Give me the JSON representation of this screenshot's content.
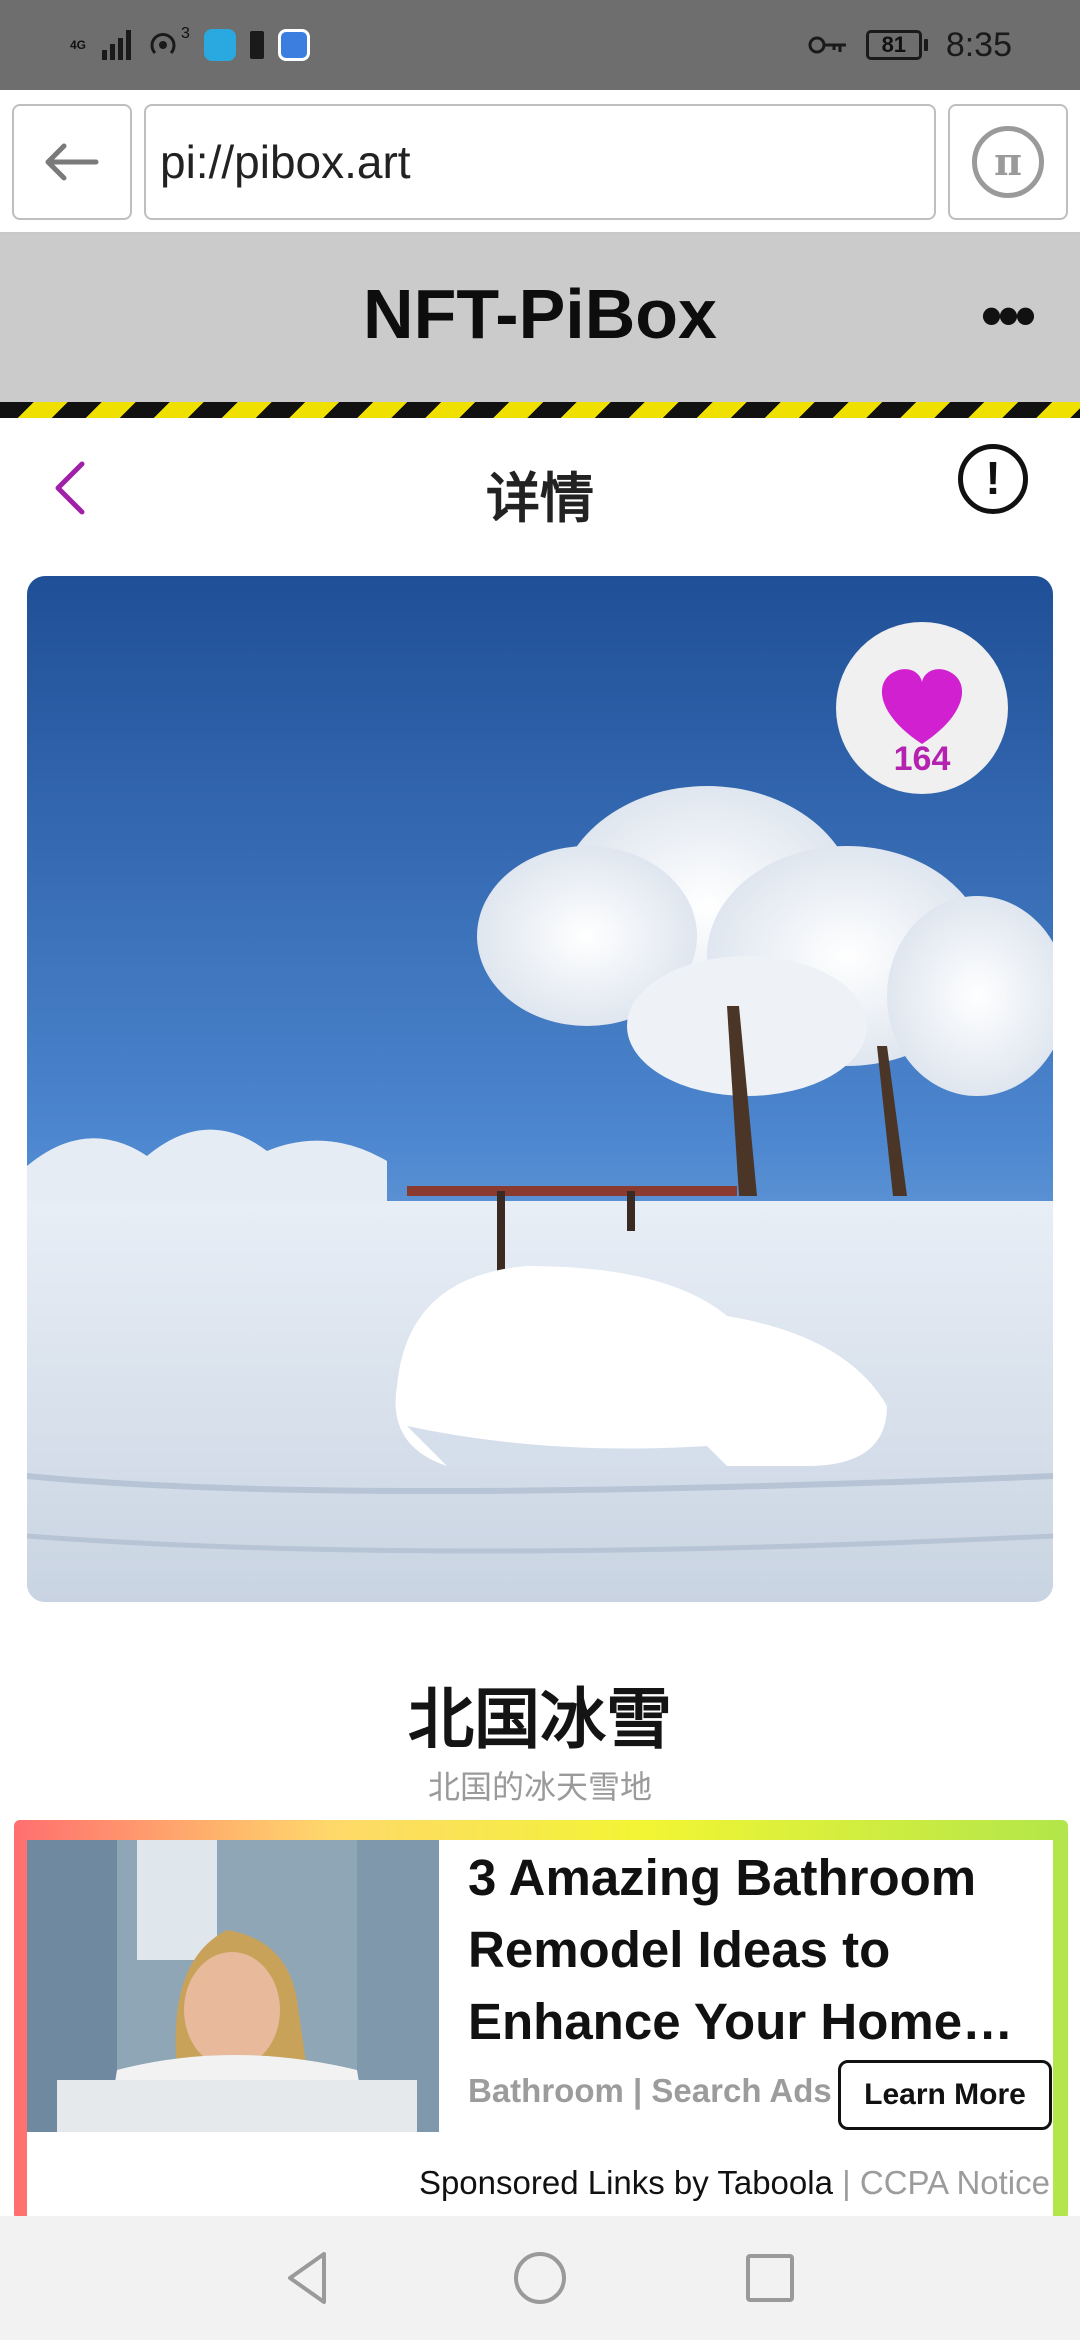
{
  "status_bar": {
    "network": "4G",
    "hotspot_count": "3",
    "battery": "81",
    "time": "8:35"
  },
  "browser": {
    "url": "pi://pibox.art",
    "pi_logo": "π"
  },
  "site": {
    "title": "NFT-PiBox",
    "more_label": "•••"
  },
  "detail": {
    "title": "详情",
    "info_label": "!"
  },
  "artwork": {
    "likes": "164",
    "name": "北国冰雪",
    "description": "北国的冰天雪地"
  },
  "ad": {
    "headline": "3 Amazing Bathroom Remodel Ideas to Enhance Your Home…",
    "source": "Bathroom | Search Ads",
    "cta": "Learn More",
    "sponsored": "Sponsored Links by Taboola",
    "separator": "|",
    "ccpa": "CCPA Notice"
  },
  "icons": {
    "status": [
      "signal-icon",
      "hotspot-icon",
      "app-icon-blue",
      "battery-saver-icon",
      "app-icon-browser",
      "key-icon",
      "battery-icon"
    ],
    "nav": [
      "back-triangle-icon",
      "home-circle-icon",
      "recents-square-icon"
    ]
  },
  "colors": {
    "status_bar": "#6e6e6e",
    "site_header": "#cbcbcb",
    "accent_purple": "#b622b0",
    "stripe_yellow": "#f0e000"
  }
}
